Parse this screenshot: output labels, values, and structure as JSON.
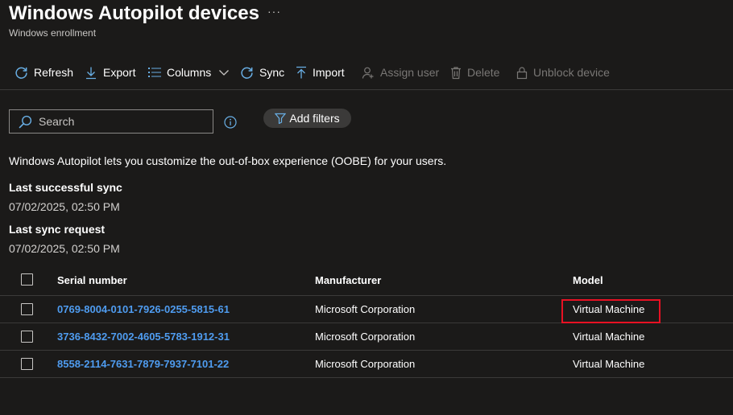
{
  "header": {
    "title": "Windows Autopilot devices",
    "more_label": "···",
    "subtitle": "Windows enrollment"
  },
  "toolbar": {
    "refresh": "Refresh",
    "export": "Export",
    "columns": "Columns",
    "sync": "Sync",
    "import": "Import",
    "assign_user": "Assign user",
    "delete": "Delete",
    "unblock_device": "Unblock device"
  },
  "search": {
    "placeholder": "Search"
  },
  "filters": {
    "add_label": "Add filters"
  },
  "description": "Windows Autopilot lets you customize the out-of-box experience (OOBE) for your users.",
  "sync_info": {
    "last_successful_label": "Last successful sync",
    "last_successful_value": "07/02/2025, 02:50 PM",
    "last_request_label": "Last sync request",
    "last_request_value": "07/02/2025, 02:50 PM"
  },
  "table": {
    "columns": [
      "Serial number",
      "Manufacturer",
      "Model"
    ],
    "rows": [
      {
        "serial": "0769-8004-0101-7926-0255-5815-61",
        "manufacturer": "Microsoft Corporation",
        "model": "Virtual Machine"
      },
      {
        "serial": "3736-8432-7002-4605-5783-1912-31",
        "manufacturer": "Microsoft Corporation",
        "model": "Virtual Machine"
      },
      {
        "serial": "8558-2114-7631-7879-7937-7101-22",
        "manufacturer": "Microsoft Corporation",
        "model": "Virtual Machine"
      }
    ]
  },
  "colors": {
    "background": "#1b1a19",
    "link": "#4f9cf0",
    "icon_accent": "#69afe5",
    "highlight": "#e81123",
    "disabled": "#797775"
  },
  "icons": [
    "refresh-icon",
    "download-icon",
    "columns-icon",
    "chevron-down-icon",
    "sync-icon",
    "upload-icon",
    "person-icon",
    "trash-icon",
    "lock-icon",
    "search-icon",
    "info-icon",
    "filter-icon"
  ]
}
